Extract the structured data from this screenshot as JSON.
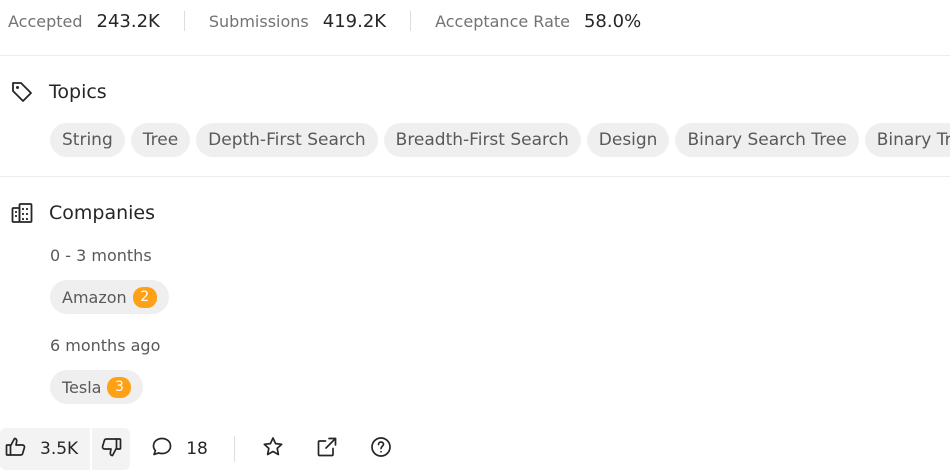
{
  "stats": {
    "accepted_label": "Accepted",
    "accepted_value": "243.2K",
    "submissions_label": "Submissions",
    "submissions_value": "419.2K",
    "acceptance_label": "Acceptance Rate",
    "acceptance_value": "58.0%"
  },
  "topics": {
    "title": "Topics",
    "icon": "tag-icon",
    "tags": [
      "String",
      "Tree",
      "Depth-First Search",
      "Breadth-First Search",
      "Design",
      "Binary Search Tree",
      "Binary Tree"
    ]
  },
  "companies": {
    "title": "Companies",
    "icon": "building-icon",
    "groups": [
      {
        "period": "0 - 3 months",
        "items": [
          {
            "name": "Amazon",
            "count": "2"
          }
        ]
      },
      {
        "period": "6 months ago",
        "items": [
          {
            "name": "Tesla",
            "count": "3"
          }
        ]
      }
    ]
  },
  "actions": {
    "likes": "3.5K",
    "comments": "18",
    "icons": [
      "thumbs-up-icon",
      "thumbs-down-icon",
      "comment-icon",
      "star-icon",
      "share-icon",
      "help-icon"
    ]
  },
  "colors": {
    "badge": "#ffa116",
    "chip_bg": "#efefef",
    "muted_text": "#737373"
  }
}
